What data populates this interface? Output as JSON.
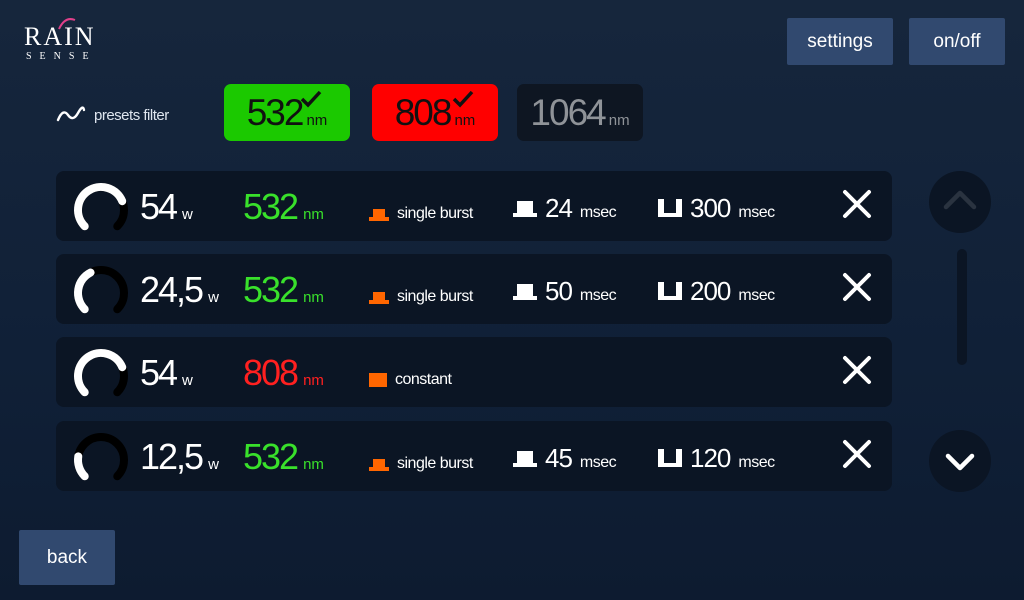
{
  "logo": {
    "main": "RAIN",
    "sub": "SENSE"
  },
  "header": {
    "settings_label": "settings",
    "onoff_label": "on/off"
  },
  "filter": {
    "label": "presets filter"
  },
  "wavelengths": [
    {
      "value": "532",
      "unit": "nm",
      "selected": true,
      "color": "#1bc900"
    },
    {
      "value": "808",
      "unit": "nm",
      "selected": true,
      "color": "#ff0000"
    },
    {
      "value": "1064",
      "unit": "nm",
      "selected": false,
      "color": "#0e1622"
    }
  ],
  "presets": [
    {
      "power": "54",
      "power_unit": "w",
      "level": 0.75,
      "wavelength": "532",
      "wl_unit": "nm",
      "wl_color": "#39e12b",
      "mode": "single burst",
      "mode_icon": "burst-icon",
      "pulse": "24",
      "pulse_unit": "msec",
      "interval": "300",
      "interval_unit": "msec"
    },
    {
      "power": "24,5",
      "power_unit": "w",
      "level": 0.4,
      "wavelength": "532",
      "wl_unit": "nm",
      "wl_color": "#39e12b",
      "mode": "single burst",
      "mode_icon": "burst-icon",
      "pulse": "50",
      "pulse_unit": "msec",
      "interval": "200",
      "interval_unit": "msec"
    },
    {
      "power": "54",
      "power_unit": "w",
      "level": 0.75,
      "wavelength": "808",
      "wl_unit": "nm",
      "wl_color": "#ff2020",
      "mode": "constant",
      "mode_icon": "constant-icon",
      "pulse": "",
      "pulse_unit": "",
      "interval": "",
      "interval_unit": ""
    },
    {
      "power": "12,5",
      "power_unit": "w",
      "level": 0.2,
      "wavelength": "532",
      "wl_unit": "nm",
      "wl_color": "#39e12b",
      "mode": "single burst",
      "mode_icon": "burst-icon",
      "pulse": "45",
      "pulse_unit": "msec",
      "interval": "120",
      "interval_unit": "msec"
    }
  ],
  "footer": {
    "back_label": "back"
  },
  "colors": {
    "accent_orange": "#ff6600",
    "button": "#31496f",
    "row_bg": "#0b1524"
  }
}
